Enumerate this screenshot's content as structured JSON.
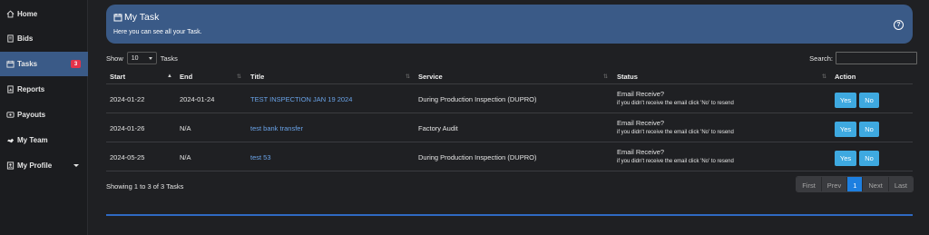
{
  "sidebar": {
    "items": [
      {
        "label": "Home"
      },
      {
        "label": "Bids"
      },
      {
        "label": "Tasks",
        "badge": "3"
      },
      {
        "label": "Reports"
      },
      {
        "label": "Payouts"
      },
      {
        "label": "My Team"
      },
      {
        "label": "My Profile"
      }
    ]
  },
  "header": {
    "title": "My Task",
    "subtitle": "Here you can see all your Task.",
    "help_icon": "?"
  },
  "controls": {
    "show_label": "Show",
    "page_length": "10",
    "entries_label": "Tasks",
    "search_label": "Search:",
    "search_value": ""
  },
  "table": {
    "headers": {
      "start": "Start",
      "end": "End",
      "title": "Title",
      "service": "Service",
      "status": "Status",
      "action": "Action"
    },
    "rows": [
      {
        "start": "2024-01-22",
        "end": "2024-01-24",
        "title": "TEST INSPECTION JAN 19 2024",
        "service": "During Production Inspection (DUPRO)",
        "status_question": "Email Receive?",
        "status_hint": "if you didn't receive the email click 'No' to resend",
        "yes": "Yes",
        "no": "No"
      },
      {
        "start": "2024-01-26",
        "end": "N/A",
        "title": "test bank transfer",
        "service": "Factory Audit",
        "status_question": "Email Receive?",
        "status_hint": "if you didn't receive the email click 'No' to resend",
        "yes": "Yes",
        "no": "No"
      },
      {
        "start": "2024-05-25",
        "end": "N/A",
        "title": "test 53",
        "service": "During Production Inspection (DUPRO)",
        "status_question": "Email Receive?",
        "status_hint": "if you didn't receive the email click 'No' to resend",
        "yes": "Yes",
        "no": "No"
      }
    ]
  },
  "footer": {
    "info": "Showing 1 to 3 of 3 Tasks",
    "pager": {
      "first": "First",
      "prev": "Prev",
      "current": "1",
      "next": "Next",
      "last": "Last"
    }
  },
  "colors": {
    "accent": "#3a5a87",
    "button": "#3ea9e0",
    "link": "#6aa3e8",
    "badge": "#e4334a",
    "page_active": "#1d7fe0"
  }
}
